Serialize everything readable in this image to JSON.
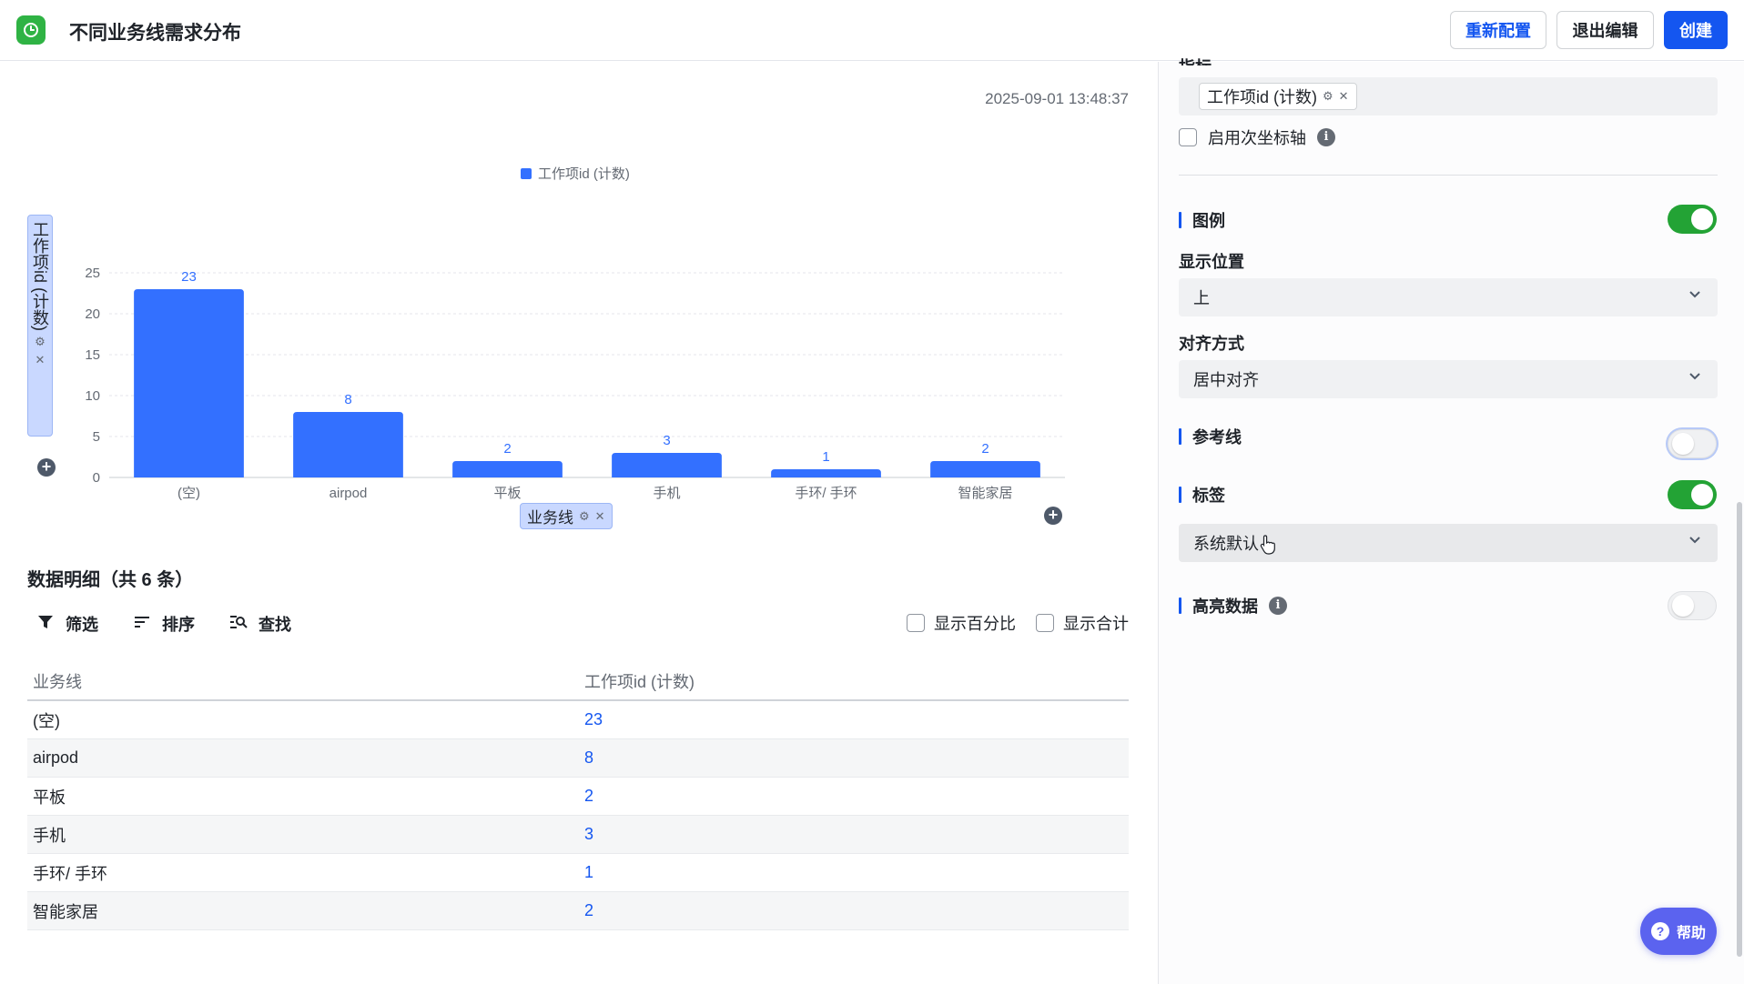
{
  "header": {
    "title": "不同业务线需求分布",
    "reconfigure_label": "重新配置",
    "exit_edit_label": "退出编辑",
    "create_label": "创建"
  },
  "chart_panel": {
    "timestamp": "2025-09-01 13:48:37",
    "y_field": "工作项id (计数)",
    "x_field": "业务线"
  },
  "chart_data": {
    "type": "bar",
    "categories": [
      "(空)",
      "airpod",
      "平板",
      "手机",
      "手环/ 手环",
      "智能家居"
    ],
    "series": [
      {
        "name": "工作项id (计数)",
        "values": [
          23,
          8,
          2,
          3,
          1,
          2
        ]
      }
    ],
    "ylim": [
      0,
      25
    ],
    "yticks": [
      0,
      5,
      10,
      15,
      20,
      25
    ],
    "ylabel": "工作项id (计数)",
    "xlabel": "业务线",
    "legend_position": "top-center",
    "grid": true,
    "bar_color": "#3370ff",
    "data_labels": true
  },
  "details": {
    "title": "数据明细（共 6 条）",
    "tools": {
      "filter": "筛选",
      "sort": "排序",
      "find": "查找"
    },
    "show_percent": "显示百分比",
    "show_total": "显示合计",
    "columns": [
      "业务线",
      "工作项id (计数)"
    ],
    "rows": [
      {
        "line": "(空)",
        "count": "23"
      },
      {
        "line": "airpod",
        "count": "8"
      },
      {
        "line": "平板",
        "count": "2"
      },
      {
        "line": "手机",
        "count": "3"
      },
      {
        "line": "手环/ 手环",
        "count": "1"
      },
      {
        "line": "智能家居",
        "count": "2"
      }
    ]
  },
  "settings": {
    "metric_label": "指标",
    "metric_tag": "工作项id (计数)",
    "secondary_axis_label": "启用次坐标轴",
    "legend": {
      "label": "图例",
      "enabled": true
    },
    "position": {
      "label": "显示位置",
      "value": "上"
    },
    "align": {
      "label": "对齐方式",
      "value": "居中对齐"
    },
    "reference_line": {
      "label": "参考线",
      "enabled": false
    },
    "labels": {
      "label": "标签",
      "enabled": true,
      "value": "系统默认"
    },
    "highlight": {
      "label": "高亮数据",
      "enabled": false
    }
  },
  "help": {
    "label": "帮助"
  },
  "colors": {
    "primary": "#1456f0",
    "toggle_on": "#23a335",
    "bar": "#3370ff",
    "help": "#5b63ef"
  }
}
